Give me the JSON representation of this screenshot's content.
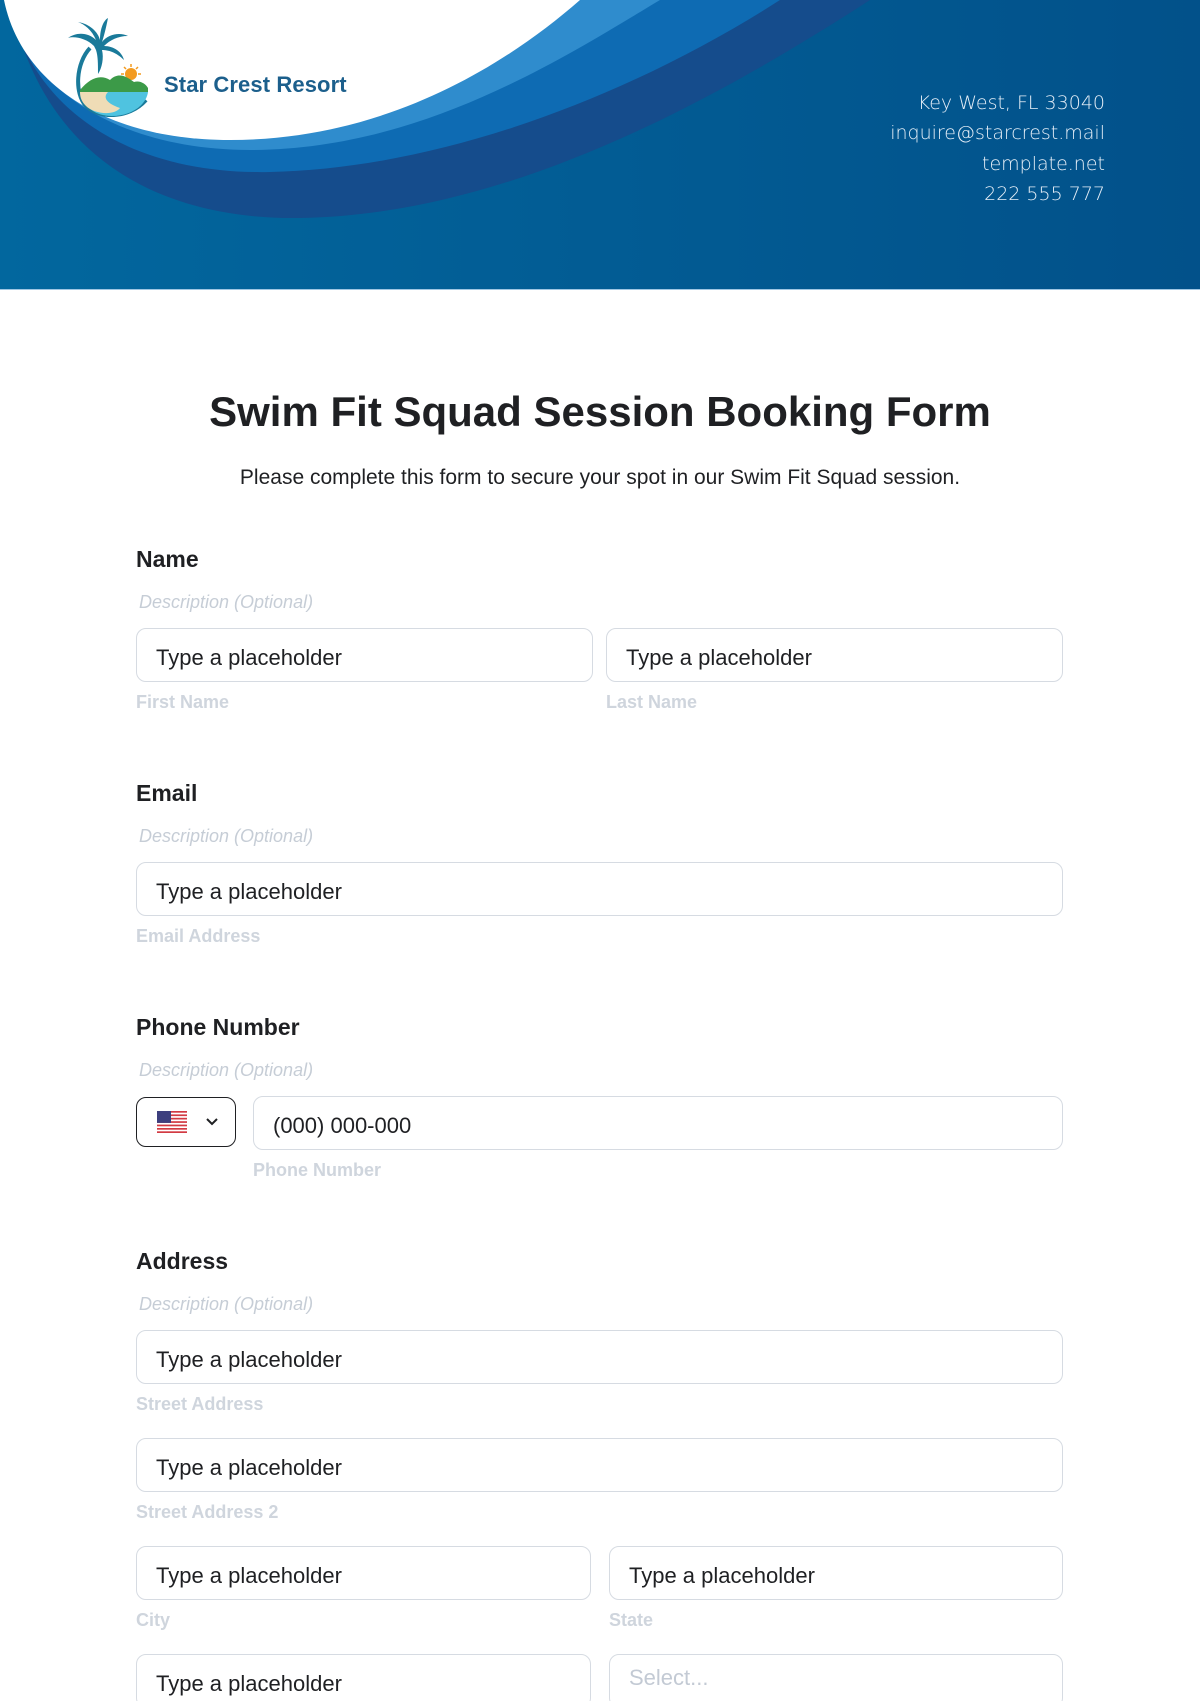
{
  "header": {
    "brand_name": "Star Crest Resort",
    "contact": {
      "address": "Key West, FL 33040",
      "email": "inquire@starcrest.mail",
      "website": "template.net",
      "phone": "222 555 777"
    },
    "colors": {
      "primary_dark": "#005a8f",
      "wave_light": "#2f8ccd",
      "wave_mid": "#0e6bb3",
      "wave_dark": "#154c8c",
      "brand_text": "#1c5f8c"
    }
  },
  "form": {
    "title": "Swim Fit Squad Session Booking Form",
    "subtitle": "Please complete this form to secure your spot in our Swim Fit Squad session.",
    "sections": {
      "name": {
        "label": "Name",
        "description": "Description (Optional)",
        "first_name": {
          "value": "Type a placeholder",
          "sublabel": "First Name"
        },
        "last_name": {
          "value": "Type a placeholder",
          "sublabel": "Last Name"
        }
      },
      "email": {
        "label": "Email",
        "description": "Description (Optional)",
        "email_address": {
          "value": "Type a placeholder",
          "sublabel": "Email Address"
        }
      },
      "phone": {
        "label": "Phone Number",
        "description": "Description (Optional)",
        "country": "US",
        "phone_number": {
          "value": "(000) 000-000",
          "sublabel": "Phone Number"
        }
      },
      "address": {
        "label": "Address",
        "description": "Description (Optional)",
        "street": {
          "value": "Type a placeholder",
          "sublabel": "Street Address"
        },
        "street2": {
          "value": "Type a placeholder",
          "sublabel": "Street Address 2"
        },
        "city": {
          "value": "Type a placeholder",
          "sublabel": "City"
        },
        "state": {
          "value": "Type a placeholder",
          "sublabel": "State"
        },
        "zip": {
          "value": "Type a placeholder"
        },
        "country_select": {
          "placeholder": "Select..."
        }
      }
    }
  }
}
